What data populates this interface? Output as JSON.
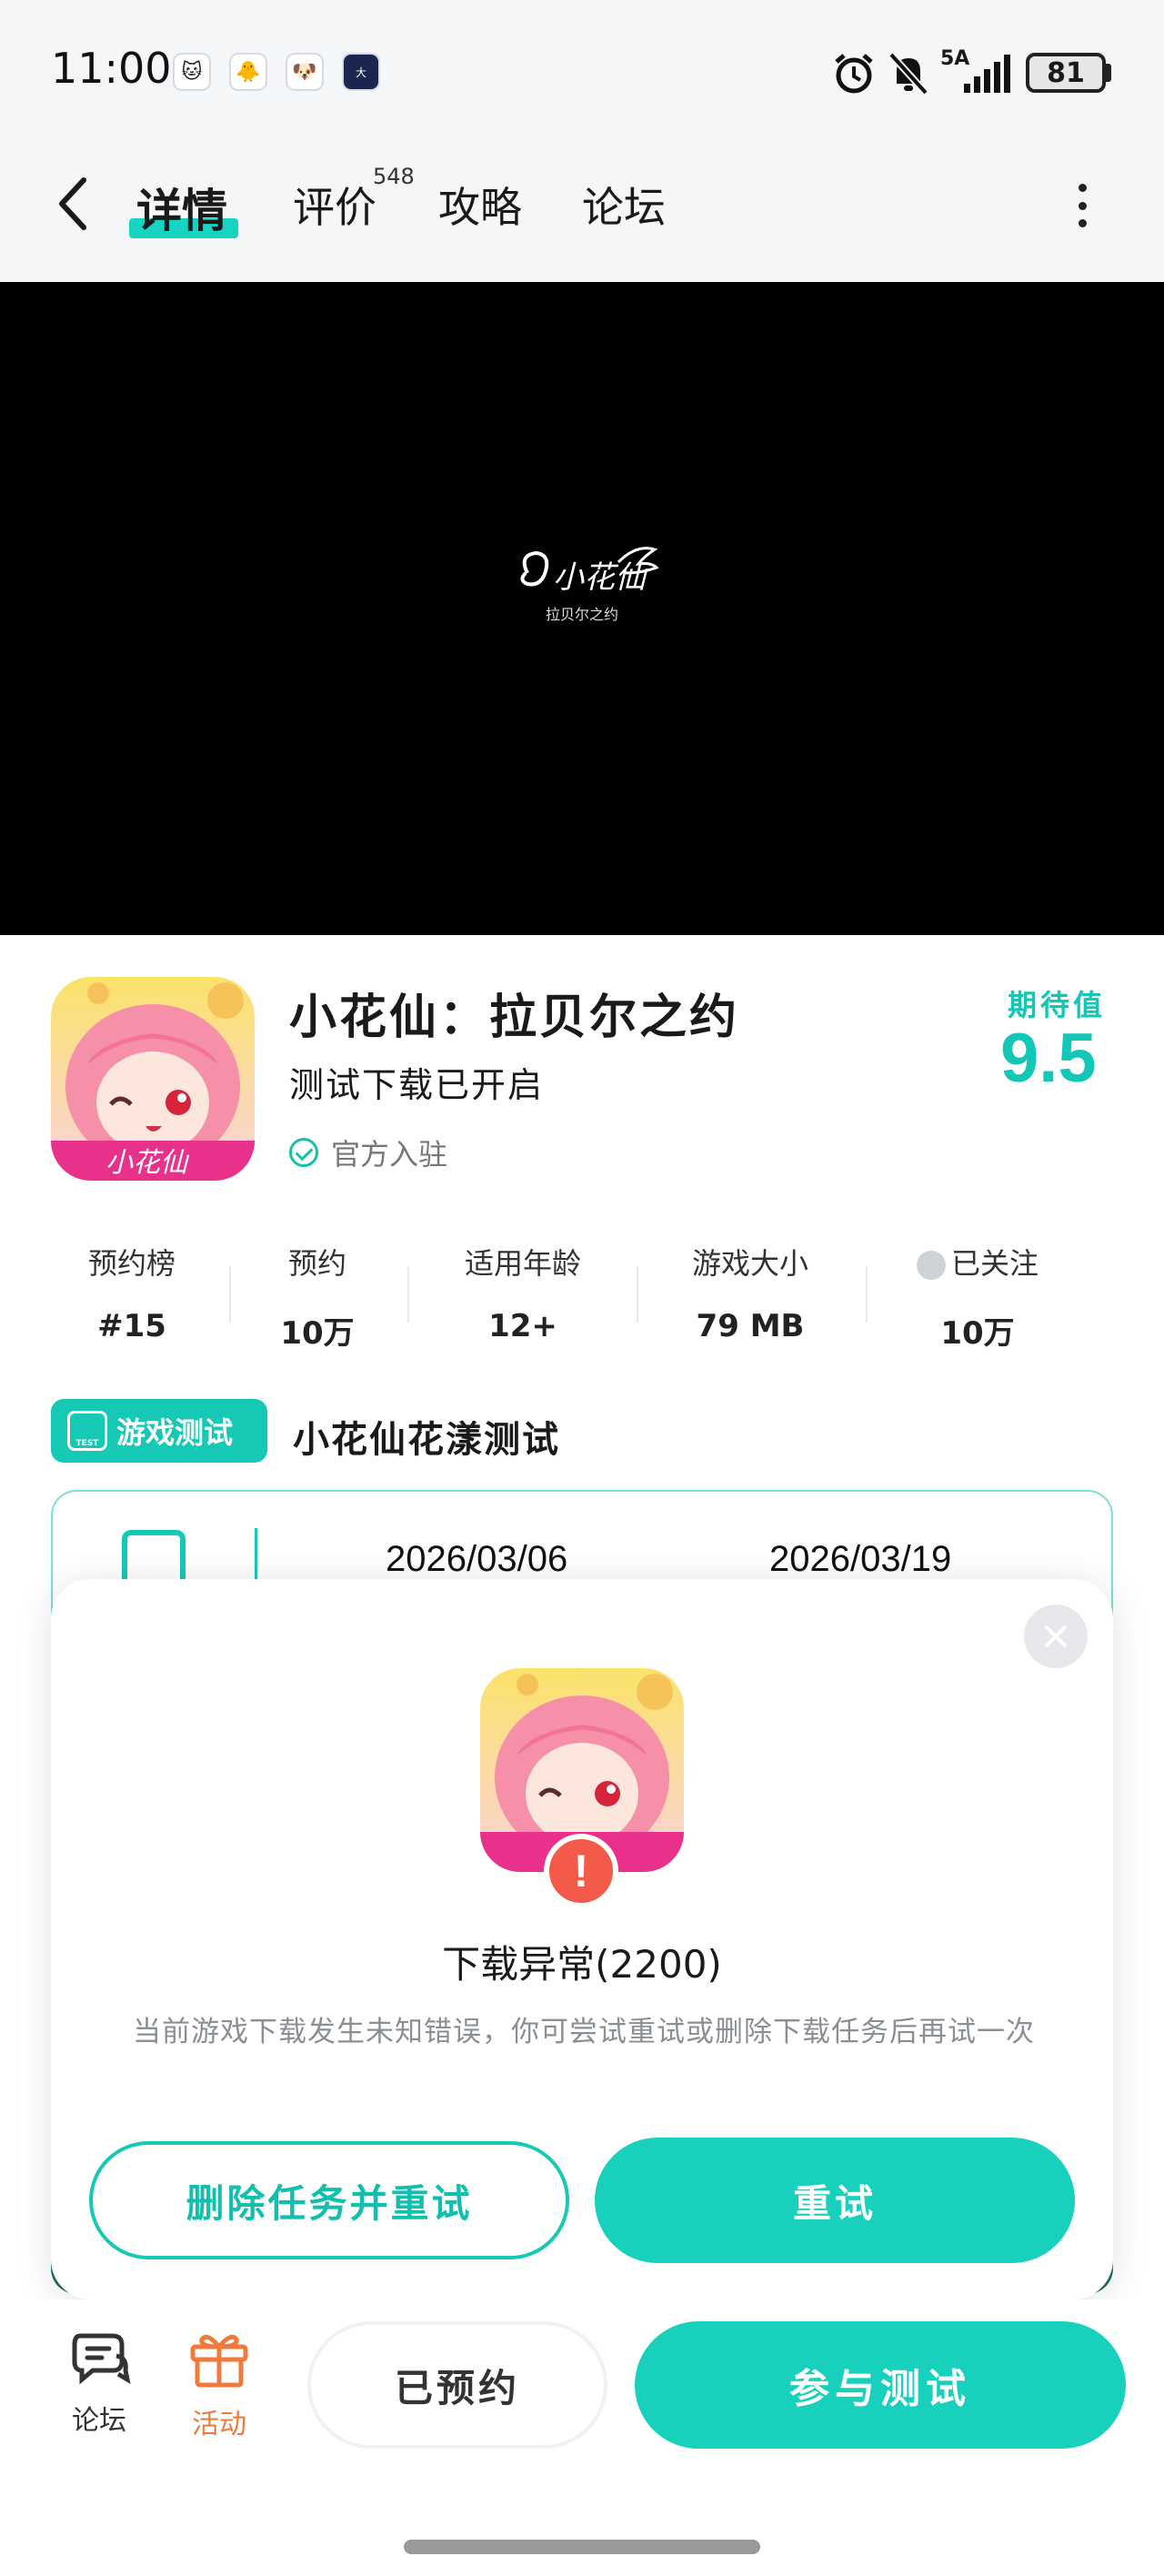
{
  "status_bar": {
    "time": "11:00",
    "network": "5A",
    "battery": "81",
    "icons": [
      "alarm-icon",
      "mute-icon",
      "signal-icon"
    ]
  },
  "nav": {
    "tabs": [
      {
        "label": "详情"
      },
      {
        "label": "评价"
      },
      {
        "label": "攻略"
      },
      {
        "label": "论坛"
      }
    ],
    "review_count": "548"
  },
  "video": {
    "logo_subtitle": "拉贝尔之约"
  },
  "game": {
    "title": "小花仙：拉贝尔之约",
    "subtitle": "测试下载已开启",
    "official": "官方入驻",
    "expect_label": "期待值",
    "expect_score": "9.5"
  },
  "stats": [
    {
      "label": "预约榜",
      "value": "#15"
    },
    {
      "label": "预约",
      "value": "10万"
    },
    {
      "label": "适用年龄",
      "value": "12+"
    },
    {
      "label": "游戏大小",
      "value": "79 MB"
    },
    {
      "label": "已关注",
      "value": "10万"
    }
  ],
  "test": {
    "badge": "游戏测试",
    "badge_small": "TEST",
    "name": "小花仙花漾测试",
    "start_date": "2026/03/06",
    "end_date": "2026/03/19"
  },
  "dialog": {
    "title": "下载异常(2200)",
    "message": "当前游戏下载发生未知错误，你可尝试重试或删除下载任务后再试一次",
    "delete_button": "删除任务并重试",
    "retry_button": "重试"
  },
  "bottom_bar": {
    "forum_label": "论坛",
    "activity_label": "活动",
    "reserved_button": "已预约",
    "join_button": "参与测试"
  },
  "colors": {
    "accent": "#18d1bd",
    "activity": "#f07a3c",
    "error": "#f35a4a"
  }
}
